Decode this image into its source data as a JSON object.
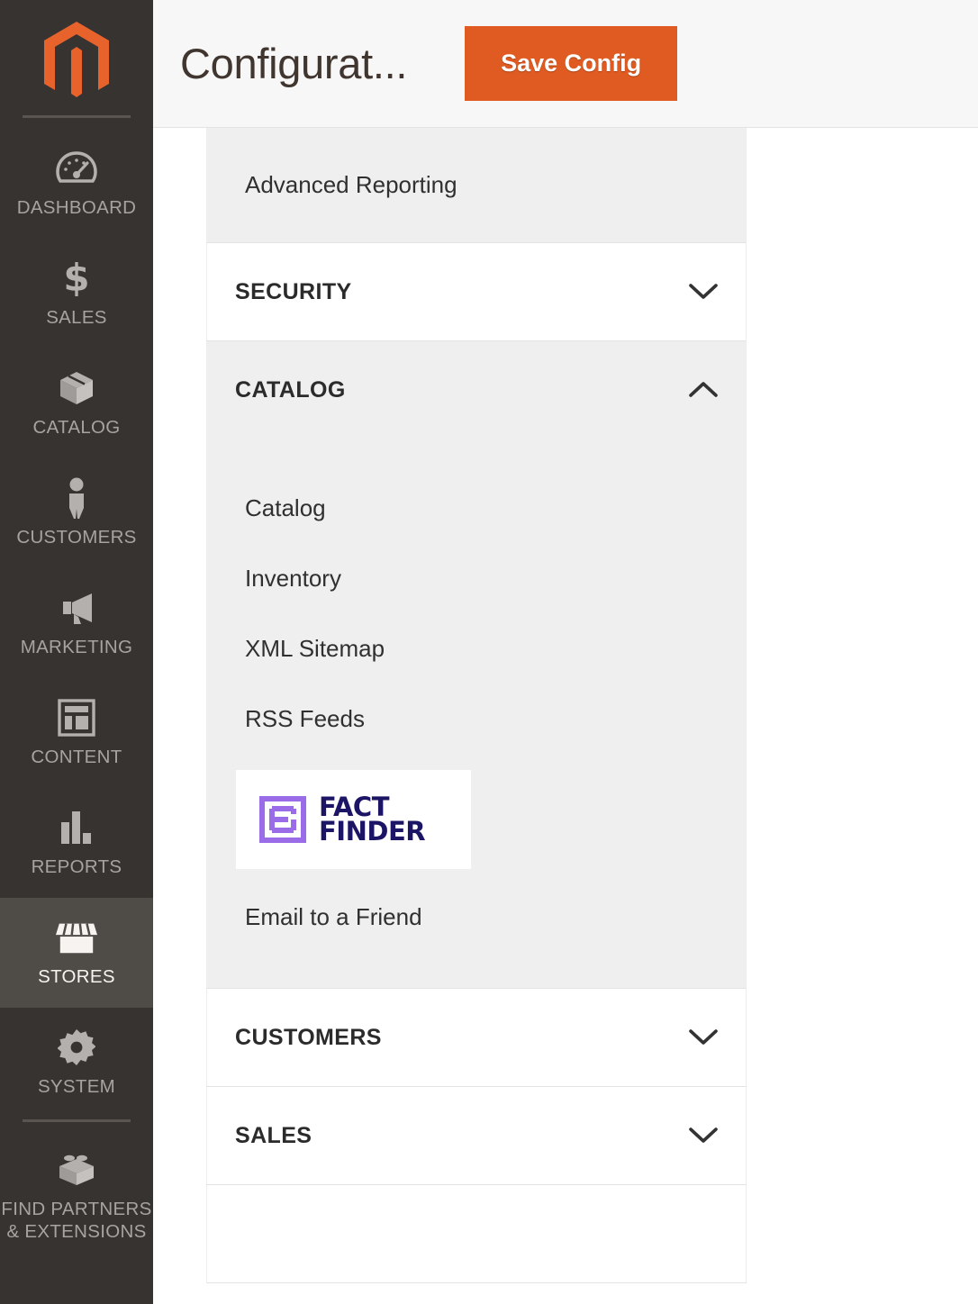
{
  "sidebar": {
    "logo": {
      "icon": "magento-logo-icon",
      "color": "#e8622c"
    },
    "items": [
      {
        "label": "DASHBOARD",
        "icon": "dashboard-gauge-icon",
        "active": false
      },
      {
        "label": "SALES",
        "icon": "dollar-sign-icon",
        "active": false
      },
      {
        "label": "CATALOG",
        "icon": "box-icon",
        "active": false
      },
      {
        "label": "CUSTOMERS",
        "icon": "person-icon",
        "active": false
      },
      {
        "label": "MARKETING",
        "icon": "megaphone-icon",
        "active": false
      },
      {
        "label": "CONTENT",
        "icon": "layout-page-icon",
        "active": false
      },
      {
        "label": "REPORTS",
        "icon": "bar-chart-icon",
        "active": false
      },
      {
        "label": "STORES",
        "icon": "storefront-icon",
        "active": true
      },
      {
        "label": "SYSTEM",
        "icon": "gear-icon",
        "active": false
      },
      {
        "label": "FIND PARTNERS\n& EXTENSIONS",
        "label_line1": "FIND PARTNERS",
        "label_line2": "& EXTENSIONS",
        "icon": "lego-brick-icon",
        "active": false
      }
    ]
  },
  "header": {
    "title": "Configurat...",
    "save_label": "Save Config",
    "save_color": "#df5b22"
  },
  "config": {
    "advanced_reporting": {
      "label": "Advanced Reporting"
    },
    "sections": [
      {
        "label": "SECURITY",
        "expanded": false,
        "chevron": "chevron-down-icon"
      },
      {
        "label": "CATALOG",
        "expanded": true,
        "chevron": "chevron-up-icon"
      },
      {
        "label": "CUSTOMERS",
        "expanded": false,
        "chevron": "chevron-down-icon"
      },
      {
        "label": "SALES",
        "expanded": false,
        "chevron": "chevron-down-icon"
      }
    ],
    "catalog_items": [
      {
        "label": "Catalog",
        "type": "text"
      },
      {
        "label": "Inventory",
        "type": "text"
      },
      {
        "label": "XML Sitemap",
        "type": "text"
      },
      {
        "label": "RSS Feeds",
        "type": "text"
      },
      {
        "label": "FACT FINDER",
        "type": "logo",
        "logo_line1": "FACT",
        "logo_line2": "FINDER",
        "mark_color": "#9a6ce8",
        "text_color": "#1c1464"
      },
      {
        "label": "Email to a Friend",
        "type": "text"
      }
    ]
  }
}
